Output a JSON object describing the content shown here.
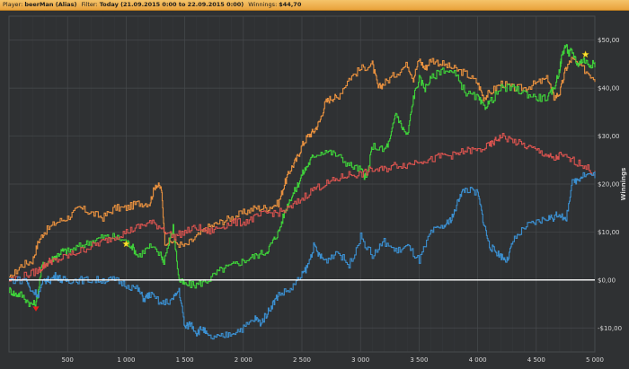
{
  "header": {
    "player_label": "Player:",
    "player_value": "beerMan (Alias)",
    "filter_label": "Filter:",
    "filter_value": "Today (21.09.2015 0:00 to 22.09.2015 0:00)",
    "winnings_label": "Winnings:",
    "winnings_value": "$44,70"
  },
  "colors": {
    "background": "#2f3133",
    "grid": "#474a4d",
    "green": "#3fd23a",
    "orange": "#e9913f",
    "red": "#d9534f",
    "blue": "#3b8fd0",
    "zero_line": "#ffffff",
    "axis_text": "#d8d8d8"
  },
  "chart_data": {
    "type": "line",
    "xlim": [
      0,
      5000
    ],
    "ylim": [
      -15,
      55
    ],
    "ylabel": "Winnings",
    "x_ticks": [
      {
        "value": 500,
        "label": "500"
      },
      {
        "value": 1000,
        "label": "1 000"
      },
      {
        "value": 1500,
        "label": "1 500"
      },
      {
        "value": 2000,
        "label": "2 000"
      },
      {
        "value": 2500,
        "label": "2 500"
      },
      {
        "value": 3000,
        "label": "3 000"
      },
      {
        "value": 3500,
        "label": "3 500"
      },
      {
        "value": 4000,
        "label": "4 000"
      },
      {
        "value": 4500,
        "label": "4 500"
      },
      {
        "value": 5000,
        "label": "5 000"
      }
    ],
    "y_ticks": [
      {
        "value": 50,
        "label": "$50,00"
      },
      {
        "value": 40,
        "label": "$40,00"
      },
      {
        "value": 30,
        "label": "$30,00"
      },
      {
        "value": 20,
        "label": "$20,00"
      },
      {
        "value": 10,
        "label": "$10,00"
      },
      {
        "value": 0,
        "label": "$0,00"
      },
      {
        "value": -10,
        "label": "-$10,00"
      }
    ],
    "grid": true,
    "series": [
      {
        "color_key": "orange",
        "x": [
          0,
          100,
          200,
          250,
          300,
          400,
          500,
          600,
          700,
          800,
          900,
          1000,
          1100,
          1200,
          1250,
          1300,
          1330,
          1400,
          1500,
          1600,
          1700,
          1800,
          1900,
          2000,
          2100,
          2200,
          2300,
          2350,
          2400,
          2450,
          2500,
          2550,
          2600,
          2650,
          2700,
          2750,
          2800,
          2900,
          3000,
          3100,
          3150,
          3200,
          3300,
          3400,
          3450,
          3500,
          3550,
          3600,
          3700,
          3800,
          3900,
          4000,
          4050,
          4100,
          4200,
          4300,
          4400,
          4500,
          4600,
          4650,
          4700,
          4750,
          4800,
          4900,
          5000
        ],
        "y": [
          0,
          3,
          4,
          8,
          10,
          12,
          13,
          15,
          14,
          13,
          15,
          15,
          16,
          16,
          20,
          19,
          8,
          8,
          7,
          9,
          11,
          12,
          13,
          14,
          15,
          15,
          16,
          20,
          23,
          25,
          28,
          30,
          31,
          33,
          37,
          38,
          38,
          42,
          44,
          45,
          40,
          41,
          43,
          45,
          42,
          46,
          44,
          46,
          45,
          44,
          43,
          41,
          38,
          39,
          41,
          40,
          40,
          41,
          42,
          38,
          39,
          44,
          46,
          44,
          42
        ]
      },
      {
        "color_key": "green",
        "x": [
          0,
          50,
          100,
          180,
          230,
          280,
          350,
          400,
          450,
          500,
          600,
          700,
          800,
          900,
          1000,
          1050,
          1100,
          1200,
          1300,
          1320,
          1400,
          1450,
          1500,
          1600,
          1700,
          1800,
          1900,
          2000,
          2100,
          2200,
          2250,
          2300,
          2350,
          2400,
          2450,
          2500,
          2550,
          2600,
          2700,
          2800,
          2900,
          3000,
          3050,
          3100,
          3200,
          3250,
          3300,
          3350,
          3400,
          3450,
          3500,
          3550,
          3600,
          3700,
          3800,
          3900,
          4000,
          4050,
          4100,
          4200,
          4300,
          4400,
          4500,
          4600,
          4650,
          4700,
          4720,
          4750,
          4780,
          4800,
          4850,
          4900,
          4950,
          5000
        ],
        "y": [
          -2,
          -3,
          -3,
          -5,
          -5,
          3,
          4,
          5,
          6,
          6,
          7,
          8,
          9,
          9,
          8,
          7,
          5,
          7,
          5,
          4,
          11,
          0,
          -1,
          -1,
          0,
          2,
          3,
          4,
          5,
          6,
          8,
          10,
          14,
          17,
          19,
          22,
          24,
          26,
          27,
          26,
          24,
          23,
          21,
          28,
          27,
          29,
          35,
          32,
          30,
          38,
          42,
          40,
          42,
          44,
          43,
          39,
          38,
          36,
          37,
          40,
          40,
          39,
          38,
          38,
          40,
          44,
          47,
          49,
          47,
          48,
          45,
          46,
          45,
          45
        ]
      },
      {
        "color_key": "red",
        "x": [
          0,
          150,
          250,
          300,
          350,
          400,
          500,
          600,
          700,
          800,
          900,
          1000,
          1100,
          1200,
          1300,
          1400,
          1500,
          1600,
          1700,
          1800,
          1900,
          2000,
          2100,
          2200,
          2300,
          2400,
          2500,
          2600,
          2700,
          2800,
          2900,
          3000,
          3100,
          3200,
          3300,
          3400,
          3500,
          3600,
          3700,
          3800,
          3900,
          4000,
          4100,
          4150,
          4200,
          4300,
          4400,
          4500,
          4600,
          4650,
          4700,
          4800,
          4900,
          5000
        ],
        "y": [
          0,
          1,
          2,
          3,
          4,
          4,
          5,
          6,
          7,
          8,
          9,
          10,
          11,
          12,
          11,
          9,
          10,
          11,
          10,
          11,
          12,
          12,
          13,
          14,
          14,
          15,
          17,
          19,
          20,
          21,
          22,
          22,
          23,
          23,
          24,
          24,
          25,
          25,
          26,
          26,
          27,
          27,
          28,
          29,
          30,
          29,
          28,
          27,
          26,
          25,
          26,
          25,
          24,
          22
        ]
      },
      {
        "color_key": "blue",
        "x": [
          0,
          150,
          180,
          250,
          300,
          350,
          400,
          450,
          500,
          600,
          700,
          800,
          900,
          1000,
          1100,
          1150,
          1200,
          1300,
          1400,
          1450,
          1500,
          1550,
          1600,
          1650,
          1700,
          1800,
          1900,
          2000,
          2100,
          2150,
          2200,
          2250,
          2300,
          2400,
          2500,
          2550,
          2600,
          2650,
          2700,
          2800,
          2900,
          3000,
          3100,
          3200,
          3300,
          3400,
          3500,
          3600,
          3700,
          3750,
          3800,
          3850,
          3900,
          4000,
          4050,
          4100,
          4150,
          4200,
          4250,
          4300,
          4400,
          4500,
          4600,
          4650,
          4700,
          4750,
          4800,
          4850,
          4900,
          5000
        ],
        "y": [
          0,
          0,
          -2,
          -3,
          0,
          0,
          1,
          0,
          0,
          0,
          0,
          0,
          0,
          -1,
          -2,
          -4,
          -3,
          -5,
          -4,
          -2,
          -10,
          -9,
          -11,
          -10,
          -12,
          -12,
          -11,
          -10,
          -8,
          -9,
          -7,
          -5,
          -3,
          -2,
          1,
          3,
          7,
          5,
          4,
          6,
          3,
          9,
          5,
          8,
          6,
          7,
          4,
          10,
          11,
          12,
          14,
          18,
          19,
          18,
          12,
          7,
          6,
          5,
          4,
          8,
          11,
          12,
          13,
          13,
          14,
          12,
          20,
          21,
          22,
          22
        ]
      }
    ],
    "markers": [
      {
        "type": "star",
        "color_key": "yellow",
        "x": 1000,
        "y": 7.5
      },
      {
        "type": "star",
        "color_key": "yellow",
        "x": 4920,
        "y": 47
      },
      {
        "type": "triangle-down",
        "color_key": "red",
        "x": 230,
        "y": -6
      }
    ],
    "zero_line": true
  }
}
